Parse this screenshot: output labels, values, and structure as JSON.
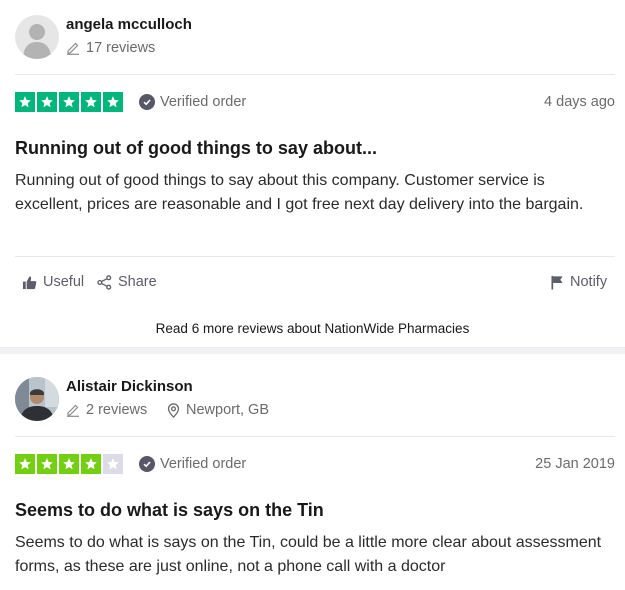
{
  "review1": {
    "author": "angela mcculloch",
    "reviews_count": "17 reviews",
    "rating": 5,
    "star_color": "#00b67a",
    "verified": "Verified order",
    "date": "4 days ago",
    "title": "Running out of good things to say about...",
    "body": "Running out of good things to say about this company. Customer service is excellent, prices are reasonable and I got free next day delivery into the bargain.",
    "actions": {
      "useful": "Useful",
      "share": "Share",
      "notify": "Notify"
    }
  },
  "more_reviews_link": "Read 6 more reviews about NationWide Pharmacies",
  "review2": {
    "author": "Alistair Dickinson",
    "reviews_count": "2 reviews",
    "location": "Newport, GB",
    "rating": 4,
    "star_color": "#73cf11",
    "verified": "Verified order",
    "date": "25 Jan 2019",
    "title": "Seems to do what is says on the Tin",
    "body": "Seems to do what is says on the Tin, could be a little more clear about assessment forms, as these are just online, not a phone call with a doctor"
  },
  "icons": [
    "user-placeholder-icon",
    "pencil-icon",
    "checkmark-icon",
    "star-icon",
    "thumbs-up-icon",
    "share-icon",
    "flag-icon",
    "location-pin-icon"
  ]
}
